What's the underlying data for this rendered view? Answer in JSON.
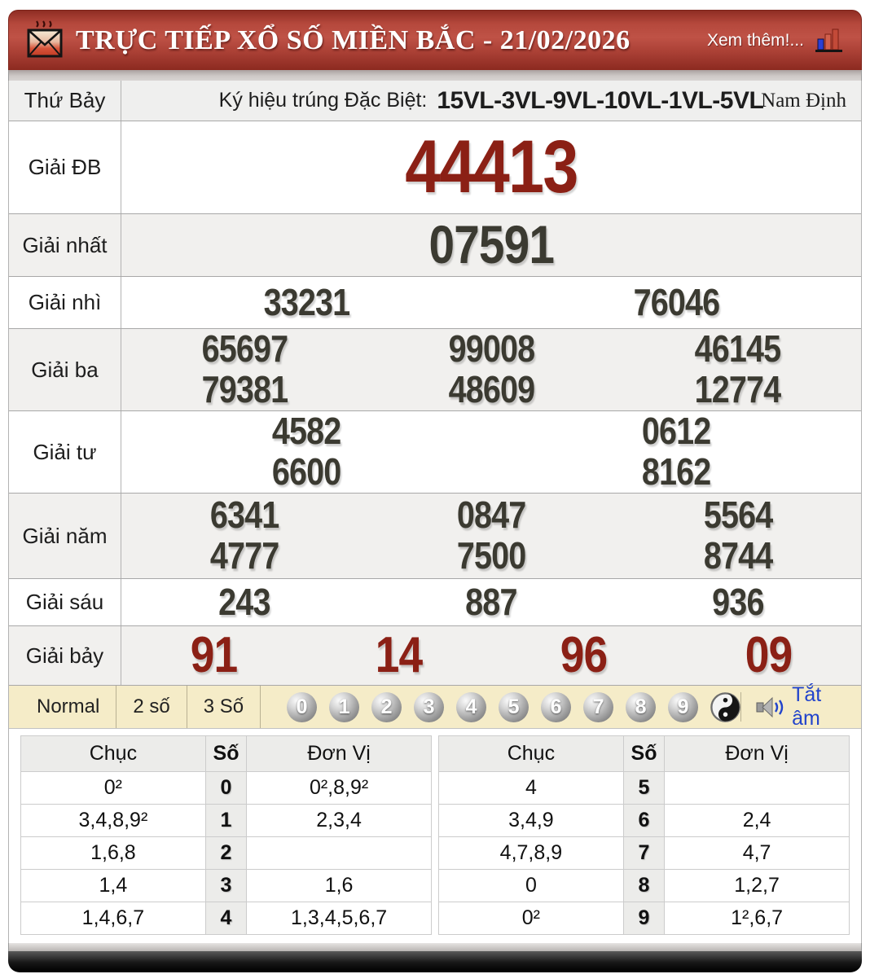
{
  "header": {
    "title": "TRỰC TIẾP XỔ SỐ MIỀN BẮC - 21/02/2026",
    "see_more": "Xem thêm!..."
  },
  "info": {
    "day": "Thứ Bảy",
    "symbol_label": "Ký hiệu trúng Đặc Biệt:",
    "symbol_value": "15VL-3VL-9VL-10VL-1VL-5VL",
    "province": "Nam Định"
  },
  "prizes": [
    {
      "label": "Giải ĐB",
      "lines": [
        [
          "44413"
        ]
      ]
    },
    {
      "label": "Giải nhất",
      "lines": [
        [
          "07591"
        ]
      ]
    },
    {
      "label": "Giải nhì",
      "lines": [
        [
          "33231",
          "76046"
        ]
      ]
    },
    {
      "label": "Giải ba",
      "lines": [
        [
          "65697",
          "99008",
          "46145"
        ],
        [
          "79381",
          "48609",
          "12774"
        ]
      ]
    },
    {
      "label": "Giải tư",
      "lines": [
        [
          "4582",
          "0612"
        ],
        [
          "6600",
          "8162"
        ]
      ]
    },
    {
      "label": "Giải năm",
      "lines": [
        [
          "6341",
          "0847",
          "5564"
        ],
        [
          "4777",
          "7500",
          "8744"
        ]
      ]
    },
    {
      "label": "Giải sáu",
      "lines": [
        [
          "243",
          "887",
          "936"
        ]
      ]
    },
    {
      "label": "Giải bảy",
      "lines": [
        [
          "91",
          "14",
          "96",
          "09"
        ]
      ]
    }
  ],
  "controls": {
    "modes": [
      "Normal",
      "2 số",
      "3 Số"
    ],
    "balls": [
      "0",
      "1",
      "2",
      "3",
      "4",
      "5",
      "6",
      "7",
      "8",
      "9"
    ],
    "mute_label": "Tắt âm"
  },
  "summary": {
    "headers": [
      "Chục",
      "Số",
      "Đơn Vị"
    ],
    "left_rows": [
      [
        "0²",
        "0",
        "0²,8,9²"
      ],
      [
        "3,4,8,9²",
        "1",
        "2,3,4"
      ],
      [
        "1,6,8",
        "2",
        ""
      ],
      [
        "1,4",
        "3",
        "1,6"
      ],
      [
        "1,4,6,7",
        "4",
        "1,3,4,5,6,7"
      ]
    ],
    "right_rows": [
      [
        "4",
        "5",
        ""
      ],
      [
        "3,4,9",
        "6",
        "2,4"
      ],
      [
        "4,7,8,9",
        "7",
        "4,7"
      ],
      [
        "0",
        "8",
        "1,2,7"
      ],
      [
        "0²",
        "9",
        "1²,6,7"
      ]
    ]
  },
  "colors": {
    "accent_red": "#8b2015",
    "header_red": "#b5483c",
    "number_dark": "#3b3a31",
    "control_bg": "#f5ecc8",
    "link_blue": "#2244cc"
  }
}
